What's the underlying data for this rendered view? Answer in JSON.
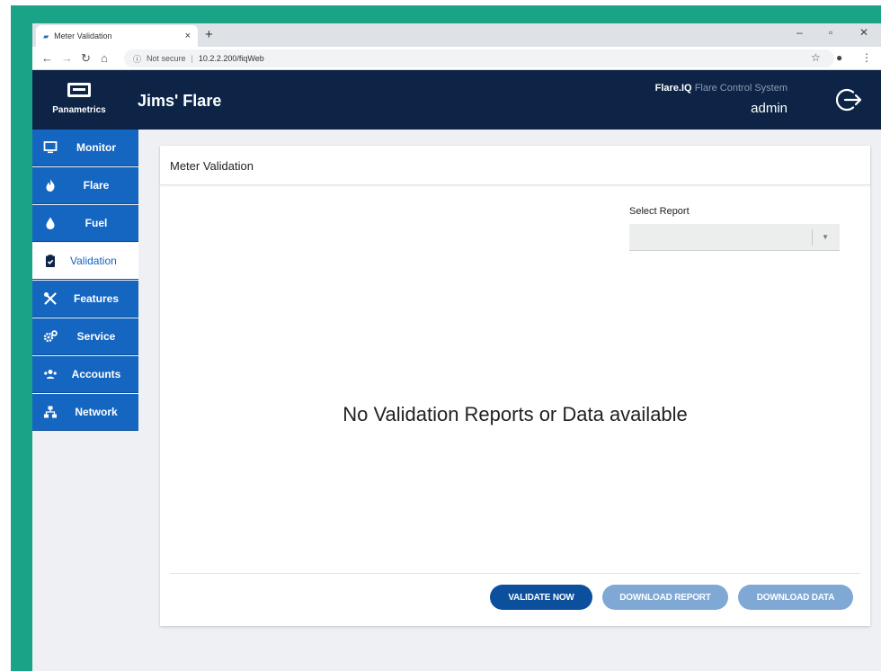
{
  "browser": {
    "tab_title": "Meter Validation",
    "tab_close": "×",
    "new_tab": "+",
    "address": {
      "security_label": "Not secure",
      "url": "10.2.2.200/fiqWeb"
    }
  },
  "header": {
    "logo_text": "Panametrics",
    "site_title": "Jims' Flare",
    "system_brand": "Flare.IQ",
    "system_product": "Flare Control System",
    "username": "admin"
  },
  "sidebar": {
    "items": [
      {
        "label": "Monitor",
        "icon": "monitor-icon"
      },
      {
        "label": "Flare",
        "icon": "flame-icon"
      },
      {
        "label": "Fuel",
        "icon": "drop-icon"
      },
      {
        "label": "Validation",
        "icon": "clipboard-check-icon",
        "active": true
      },
      {
        "label": "Features",
        "icon": "tools-icon"
      },
      {
        "label": "Service",
        "icon": "gears-icon"
      },
      {
        "label": "Accounts",
        "icon": "users-icon"
      },
      {
        "label": "Network",
        "icon": "network-icon"
      }
    ]
  },
  "main": {
    "title": "Meter Validation",
    "select_report_label": "Select Report",
    "select_report_value": "",
    "empty_message": "No Validation Reports or Data available",
    "buttons": {
      "validate_now": "VALIDATE NOW",
      "download_report": "DOWNLOAD REPORT",
      "download_data": "DOWNLOAD DATA"
    }
  },
  "colors": {
    "header_bg": "#0d2447",
    "nav_bg": "#1566c0",
    "primary_button": "#0c4f9c",
    "disabled_button": "#7fa8d4",
    "frame": "#1aa386"
  }
}
